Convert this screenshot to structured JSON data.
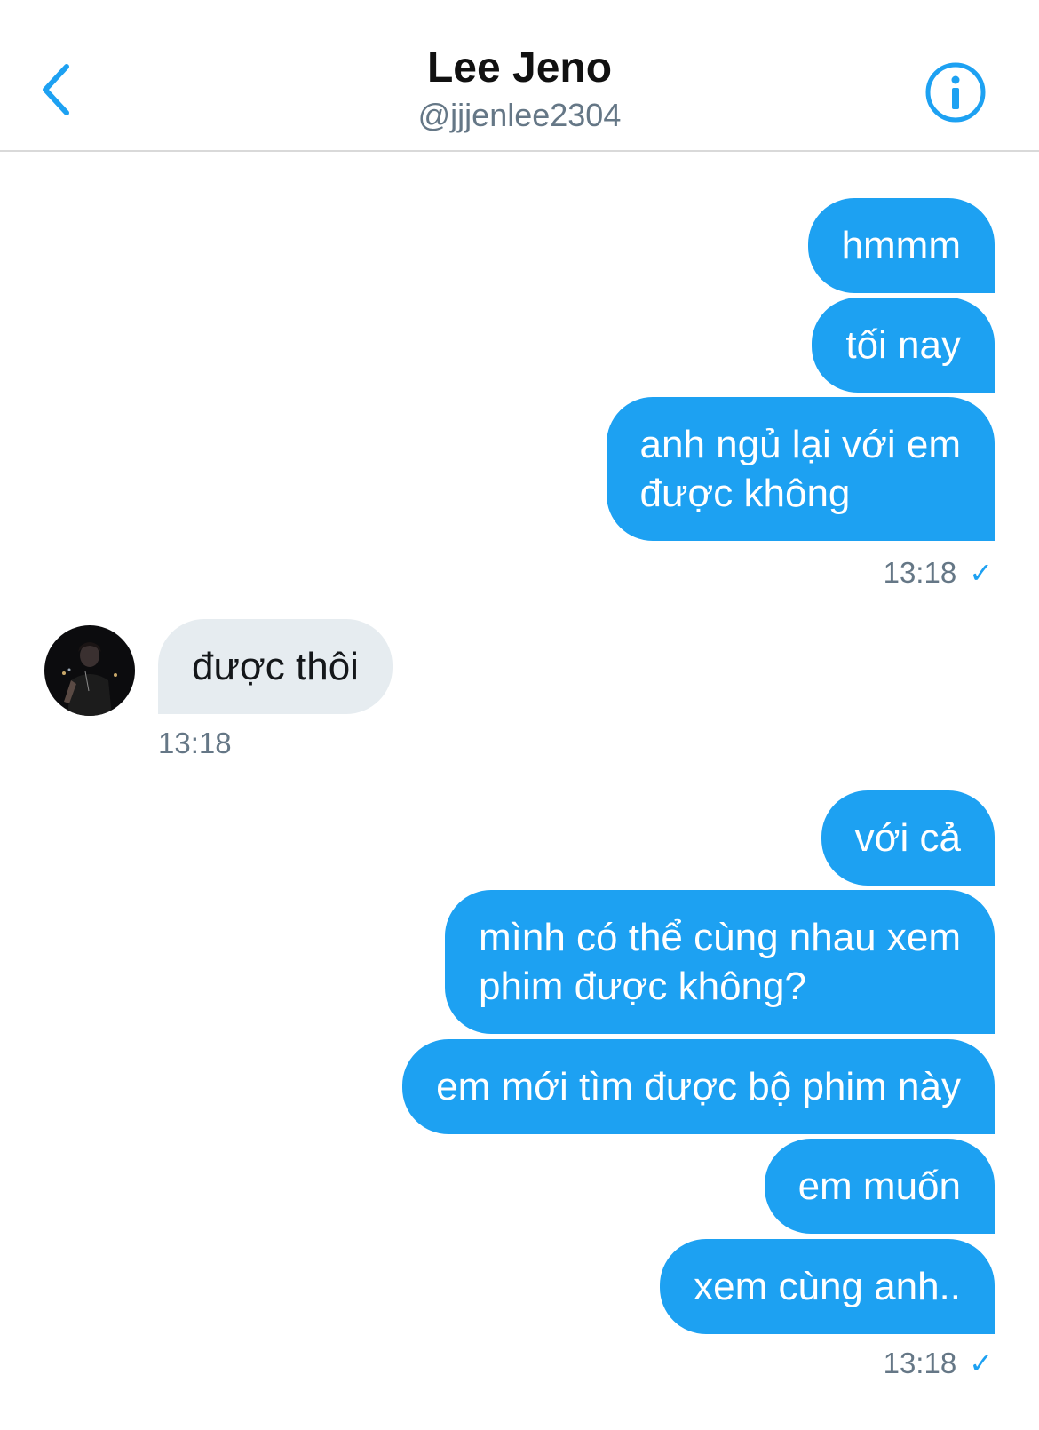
{
  "header": {
    "back_icon": "chevron-left-icon",
    "title": "Lee Jeno",
    "handle": "@jjjenlee2304",
    "info_icon": "info-icon"
  },
  "colors": {
    "accent": "#1da1f2",
    "incoming_bubble": "#e6ecf0",
    "muted_text": "#657786"
  },
  "messages": [
    {
      "direction": "out",
      "lines": [
        "hmmm"
      ]
    },
    {
      "direction": "out",
      "lines": [
        "tối nay"
      ]
    },
    {
      "direction": "out",
      "lines": [
        "anh ngủ lại với em",
        "được không"
      ]
    },
    {
      "direction": "out",
      "time": "13:18",
      "read": "✓"
    },
    {
      "direction": "in",
      "lines": [
        "được thôi"
      ]
    },
    {
      "direction": "in",
      "time": "13:18"
    },
    {
      "direction": "out",
      "lines": [
        "với cả"
      ]
    },
    {
      "direction": "out",
      "lines": [
        "mình có thể cùng nhau xem",
        "phim được không?"
      ]
    },
    {
      "direction": "out",
      "lines": [
        "em mới tìm được bộ phim này"
      ]
    },
    {
      "direction": "out",
      "lines": [
        "em muốn"
      ]
    },
    {
      "direction": "out",
      "lines": [
        "xem cùng anh.."
      ]
    },
    {
      "direction": "out",
      "time": "13:18",
      "read": "✓"
    }
  ]
}
